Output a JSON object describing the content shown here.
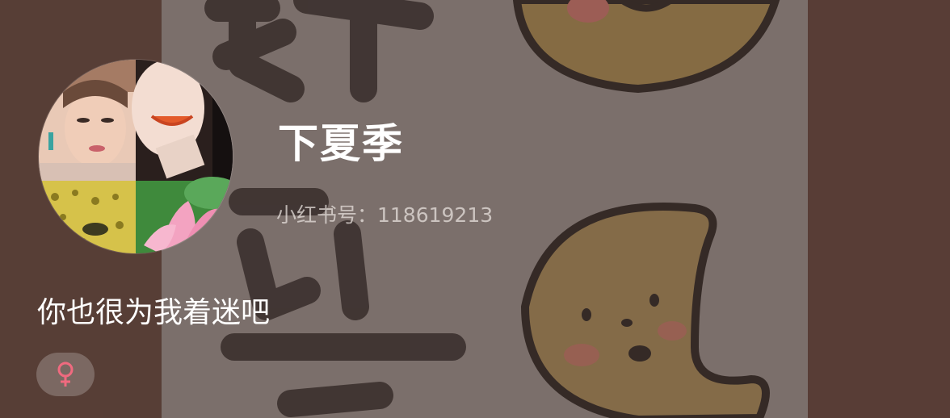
{
  "profile": {
    "nickname": "下夏季",
    "red_id": "小红书号：118619213",
    "bio": "你也很为我着迷吧",
    "gender_icon": "female-icon",
    "gender_color": "#f06a7f"
  },
  "banner": {
    "background_color": "#6a4b42",
    "panel_color": "#9b8d89",
    "text_color": "#3a2f2c",
    "moon_color": "#a88a5a"
  },
  "avatar": {
    "icon": "avatar-collage"
  }
}
